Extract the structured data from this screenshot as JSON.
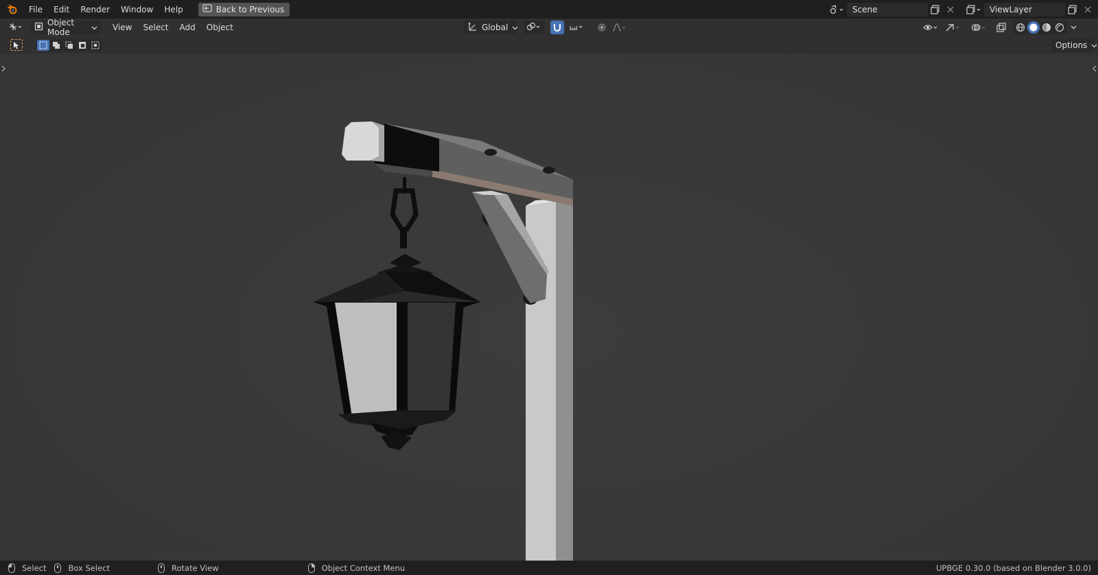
{
  "topbar": {
    "menus": [
      "File",
      "Edit",
      "Render",
      "Window",
      "Help"
    ],
    "back_button": "Back to Previous",
    "scene_name": "Scene",
    "view_layer_name": "ViewLayer"
  },
  "header": {
    "mode": "Object Mode",
    "menus": [
      "View",
      "Select",
      "Add",
      "Object"
    ],
    "transform_orientation": "Global",
    "options_label": "Options"
  },
  "statusbar": {
    "select": "Select",
    "box_select": "Box Select",
    "rotate_view": "Rotate View",
    "context_menu": "Object Context Menu",
    "version": "UPBGE 0.30.0 (based on Blender 3.0.0)"
  },
  "colors": {
    "accent": "#4772b3",
    "active_tool": "#e5a050",
    "viewport_bg": "#3a3a3a"
  }
}
